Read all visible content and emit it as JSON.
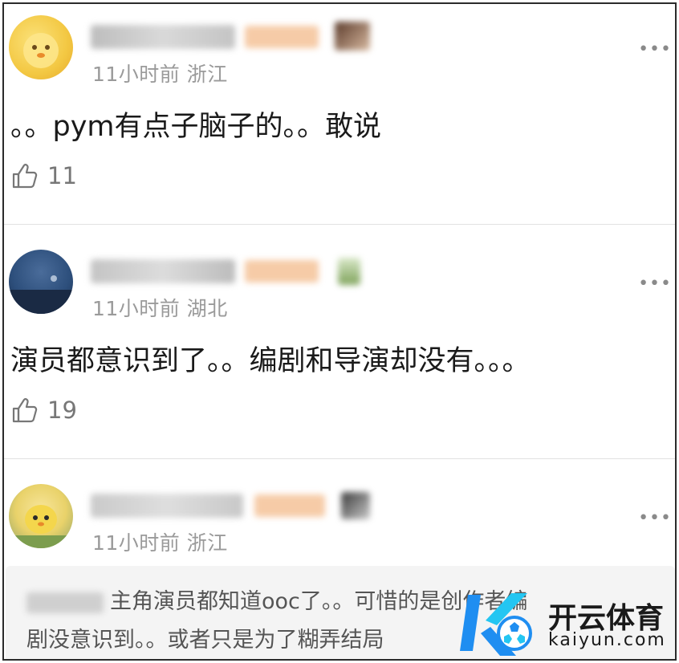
{
  "comments": [
    {
      "meta": "11小时前 浙江",
      "text": "。。pym有点子脑子的。。敢说",
      "likes": "11",
      "avatar_color": "#f3c843",
      "name_blur_color": "#cfcfcf",
      "badge_color": "#f4c9a8"
    },
    {
      "meta": "11小时前 湖北",
      "text": "演员都意识到了。。编剧和导演却没有。。。",
      "likes": "19",
      "avatar_color": "#2d4f7c",
      "name_blur_color": "#cfcfcf",
      "badge_color": "#f4c9a8"
    },
    {
      "meta": "11小时前 浙江",
      "text": "",
      "likes": "",
      "avatar_color": "#e9d26a",
      "name_blur_color": "#d6d6d6",
      "badge_color": "#f4c9a8"
    }
  ],
  "more_label": "•••",
  "reply": {
    "line1": "主角演员都知道ooc了。。可惜的是创作者编",
    "line2": "剧没意识到。。或者只是为了糊弄结局"
  },
  "watermark": {
    "title": "开云体育",
    "subtitle": "kaiyun.com",
    "brand_blue": "#1f8ef1",
    "brand_cyan": "#24c6f2"
  },
  "icons": {
    "like": "thumbs-up-icon",
    "more": "more-dots-icon"
  }
}
